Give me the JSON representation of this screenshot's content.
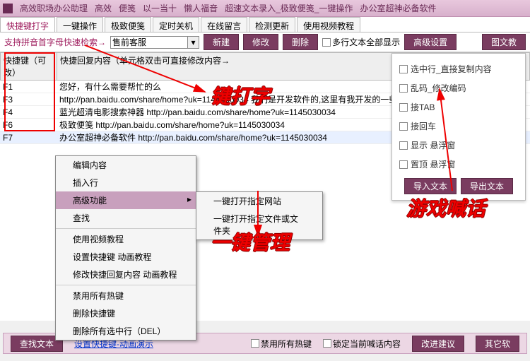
{
  "titlebar": {
    "app": "高效职场办公助理",
    "links": [
      "高效",
      "便笺",
      "以一当十",
      "懒人福音",
      "超速文本录入_极致便笺_一键操作",
      "办公室超神必备软件"
    ]
  },
  "tabs": [
    {
      "label": "快捷键打字",
      "active": true
    },
    {
      "label": "一键操作"
    },
    {
      "label": "极致便笺"
    },
    {
      "label": "定时关机"
    },
    {
      "label": "在线留言"
    },
    {
      "label": "检测更新"
    },
    {
      "label": "使用视频教程"
    }
  ],
  "toolbar": {
    "pinyin_label": "支持拼音首字母快速检索→",
    "combo_value": "售前客服",
    "btn_new": "新建",
    "btn_edit": "修改",
    "btn_delete": "删除",
    "chk_multiline": "多行文本全部显示",
    "btn_adv": "高级设置",
    "btn_imgtext": "图文教"
  },
  "table": {
    "h1": "快捷键（可改）",
    "h2": "快捷回复内容（单元格双击可直接修改内容→",
    "rows": [
      {
        "k": "F1",
        "v": "您好，有什么需要帮忙的么"
      },
      {
        "k": "F3",
        "v": "http://pan.baidu.com/share/home?uk=1145030034  我们是开发软件的,这里有我开发的一些软件"
      },
      {
        "k": "F4",
        "v": "蓝光超清电影搜索神器 http://pan.baidu.com/share/home?uk=1145030034"
      },
      {
        "k": "F6",
        "v": "极致便笺 http://pan.baidu.com/share/home?uk=1145030034"
      },
      {
        "k": "F7",
        "v": "办公室超神必备软件 http://pan.baidu.com/share/home?uk=1145030034"
      }
    ]
  },
  "context": {
    "items": [
      {
        "label": "编辑内容"
      },
      {
        "label": "插入行"
      },
      {
        "label": "高级功能",
        "hl": true,
        "sub": true
      },
      {
        "label": "查找"
      },
      {
        "sep": true
      },
      {
        "label": "使用视频教程"
      },
      {
        "label": "设置快捷键 动画教程"
      },
      {
        "label": "修改快捷回复内容 动画教程"
      },
      {
        "sep": true
      },
      {
        "label": "禁用所有热键"
      },
      {
        "label": "删除快捷键"
      },
      {
        "label": "删除所有选中行（DEL）"
      }
    ],
    "submenu": [
      "一键打开指定网站",
      "一键打开指定文件或文件夹"
    ]
  },
  "settings": {
    "opts": [
      "选中行_直接复制内容",
      "乱码_修改编码",
      "接TAB",
      "接回车",
      "显示 悬浮窗",
      "置顶 悬浮窗"
    ],
    "import": "导入文本",
    "export": "导出文本"
  },
  "bottom": {
    "btn_search": "查找文本",
    "link_set": "设置快捷键-动画演示",
    "chk_disable": "禁用所有热键",
    "chk_lock": "锁定当前喊话内容",
    "btn_suggest": "改进建议",
    "btn_other": "其它软"
  },
  "annots": {
    "a1": "键打字",
    "a2": "一键管理",
    "a3": "游戏喊话"
  }
}
